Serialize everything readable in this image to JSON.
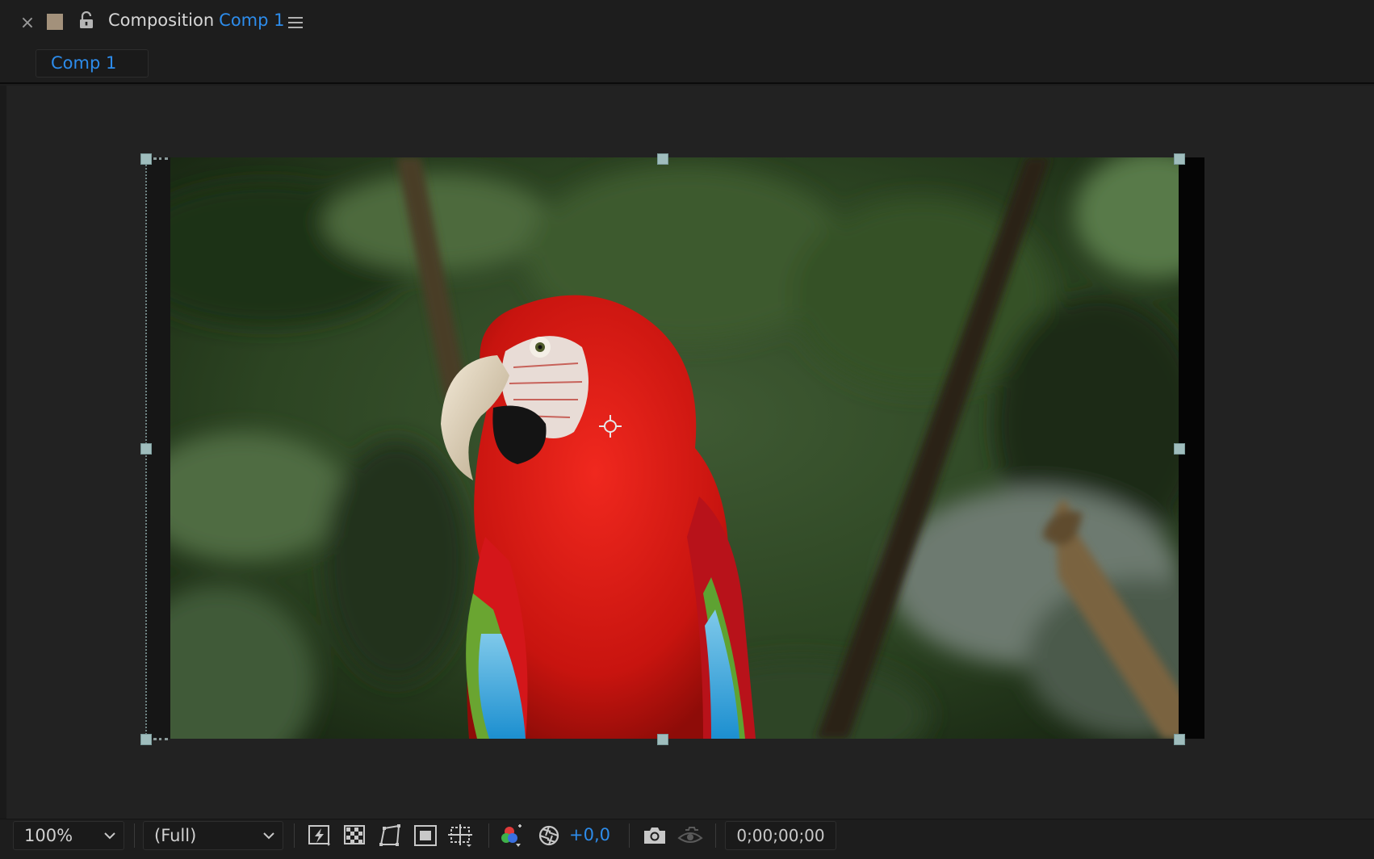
{
  "panel": {
    "close_glyph": "×",
    "label_color": "#a3917b",
    "title_prefix": "Composition",
    "title_name": "Comp 1",
    "menu_icon": "hamburger-menu-icon",
    "lock_icon": "unlocked-padlock-icon"
  },
  "tabs": [
    {
      "label": "Comp 1",
      "active": true
    }
  ],
  "viewer": {
    "content": "parrot-footage",
    "background": "#222222"
  },
  "toolbar": {
    "zoom": "100%",
    "resolution": "(Full)",
    "exposure": "+0,0",
    "timecode": "0;00;00;00",
    "icons": [
      "fast-previews-icon",
      "transparency-grid-icon",
      "mask-visibility-icon",
      "region-of-interest-icon",
      "grid-guides-icon",
      "color-channels-icon",
      "reset-exposure-icon",
      "snapshot-camera-icon",
      "show-snapshot-icon"
    ],
    "accent_color": "#2d8ceb"
  }
}
